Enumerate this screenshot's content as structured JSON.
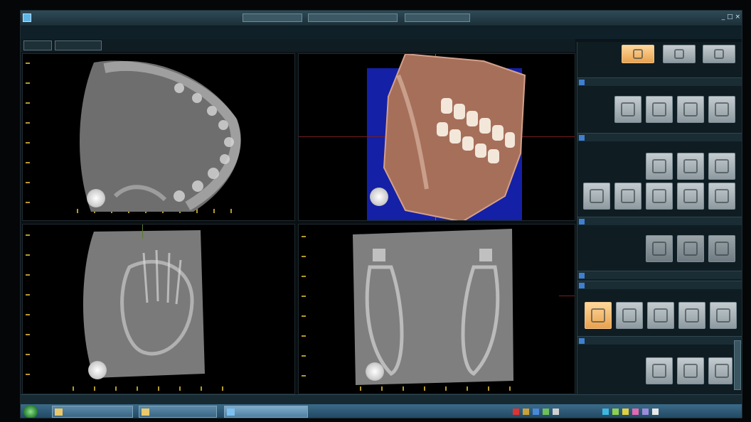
{
  "window": {
    "title": "",
    "controls": "_ □ ×"
  },
  "menu": {
    "items": [
      "",
      "",
      "",
      ""
    ]
  },
  "tabs": {
    "items": [
      "",
      ""
    ]
  },
  "viewports": [
    {
      "name": "axial-view"
    },
    {
      "name": "3d-volume-view"
    },
    {
      "name": "sagittal-view"
    },
    {
      "name": "coronal-view"
    }
  ],
  "side_panel": {
    "sections": [
      {
        "label": ""
      },
      {
        "label": ""
      },
      {
        "label": ""
      },
      {
        "label": ""
      },
      {
        "label": ""
      },
      {
        "label": ""
      }
    ]
  },
  "status": {
    "left": "",
    "right": ""
  },
  "taskbar": {
    "items": [
      "",
      "",
      ""
    ],
    "clock": ""
  },
  "colors": {
    "accent_blue": "#3f7fd0",
    "active_tool": "#e8a24f",
    "volume_bg": "#1420a6",
    "ruler": "#b79a2a",
    "crosshair_red": "#7a1e1e"
  }
}
